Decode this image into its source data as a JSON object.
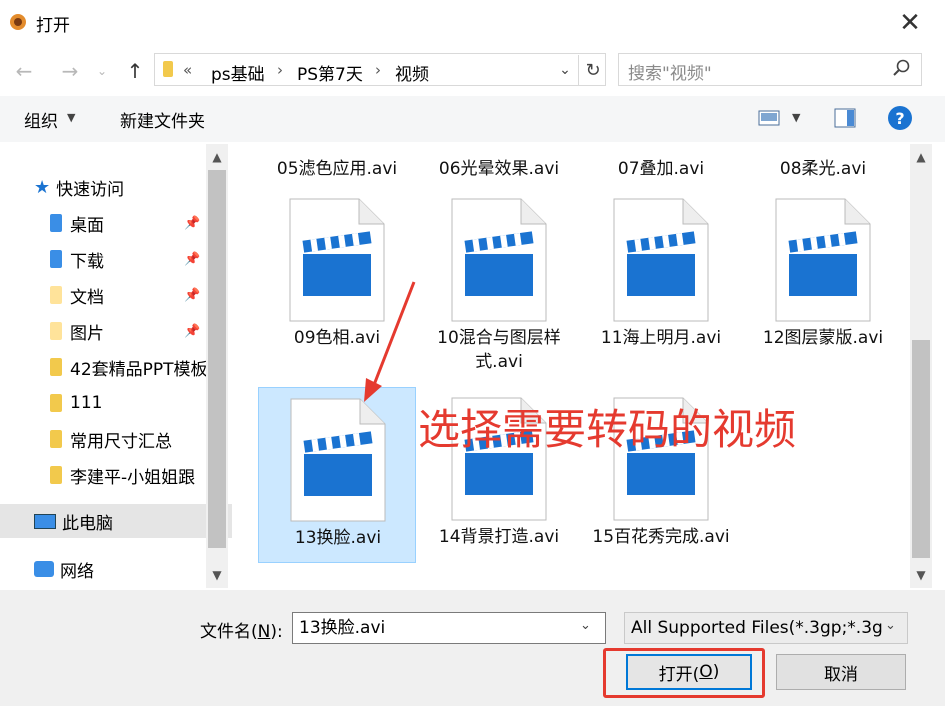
{
  "window": {
    "title": "打开"
  },
  "address": {
    "overflow": "«",
    "crumbs": [
      "ps基础",
      "PS第7天",
      "视频"
    ]
  },
  "search": {
    "placeholder": "搜索\"视频\""
  },
  "toolbar": {
    "organize": "组织",
    "new_folder": "新建文件夹"
  },
  "sidebar": {
    "quick_access": "快速访问",
    "items": [
      {
        "label": "桌面",
        "pinned": true
      },
      {
        "label": "下载",
        "pinned": true
      },
      {
        "label": "文档",
        "pinned": true
      },
      {
        "label": "图片",
        "pinned": true
      },
      {
        "label": "42套精品PPT模板",
        "pinned": false
      },
      {
        "label": "111",
        "pinned": false
      },
      {
        "label": "常用尺寸汇总",
        "pinned": false
      },
      {
        "label": "李建平-小姐姐跟",
        "pinned": false
      }
    ],
    "this_pc": "此电脑",
    "network": "网络"
  },
  "files": {
    "top_row": [
      "05滤色应用.avi",
      "06光晕效果.avi",
      "07叠加.avi",
      "08柔光.avi"
    ],
    "row2": [
      "09色相.avi",
      "10混合与图层样式.avi",
      "11海上明月.avi",
      "12图层蒙版.avi"
    ],
    "row3": [
      "13换脸.avi",
      "14背景打造.avi",
      "15百花秀完成.avi"
    ],
    "selected": "13换脸.avi"
  },
  "annotation": "选择需要转码的视频",
  "bottom": {
    "filename_label_pre": "文件名(",
    "filename_label_key": "N",
    "filename_label_post": "):",
    "filename_value": "13换脸.avi",
    "filter": "All Supported Files(*.3gp;*.3g",
    "open_pre": "打开(",
    "open_key": "O",
    "open_post": ")",
    "cancel": "取消"
  },
  "colors": {
    "accent": "#0078d7",
    "annotation": "#e53a2f",
    "selection": "#cce8ff",
    "clapper": "#1a73d1"
  }
}
